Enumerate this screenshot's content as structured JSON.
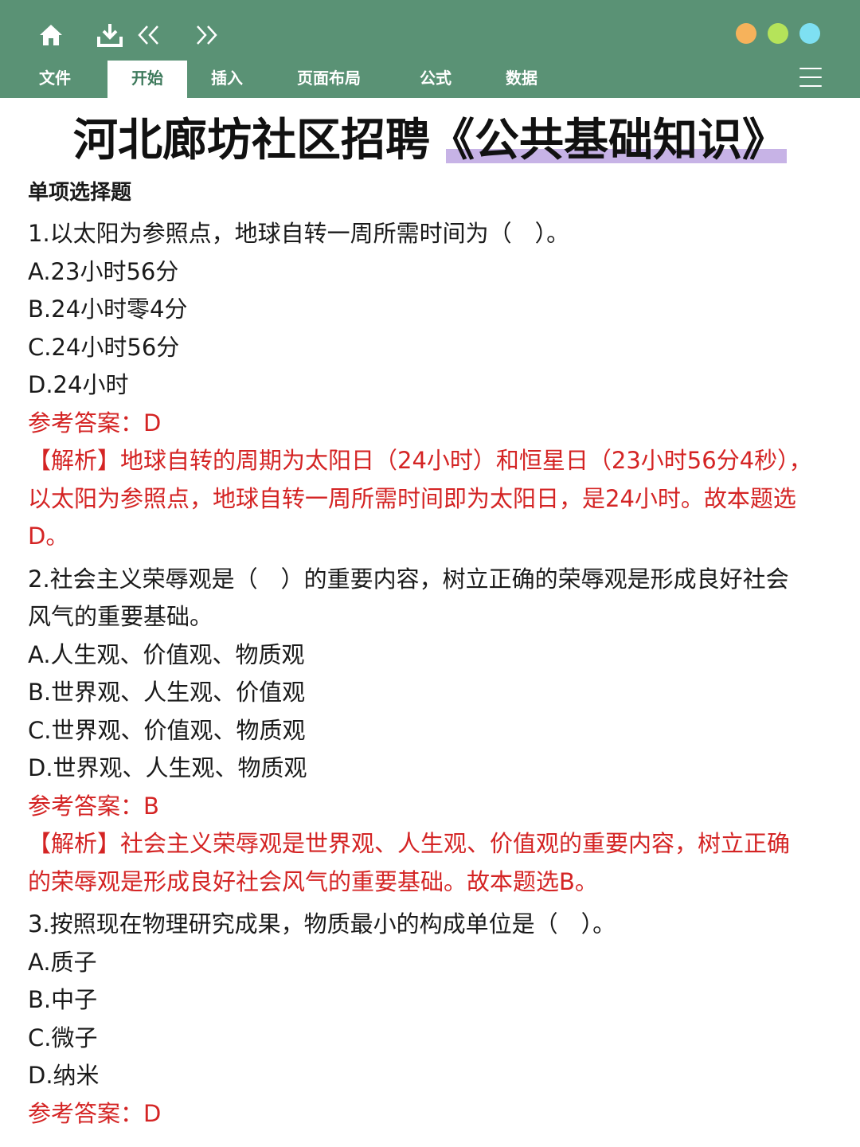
{
  "toolbar": {
    "icons": [
      "home-icon",
      "download-icon",
      "double-chevron-left-icon",
      "double-chevron-right-icon"
    ],
    "window_dots": [
      "#f6b25b",
      "#b5e35a",
      "#7ee0f2"
    ],
    "bar_color": "#5a9275",
    "tabs": [
      {
        "label": "文件",
        "active": false
      },
      {
        "label": "开始",
        "active": true
      },
      {
        "label": "插入",
        "active": false
      },
      {
        "label": "页面布局",
        "active": false
      },
      {
        "label": "公式",
        "active": false
      },
      {
        "label": "数据",
        "active": false
      }
    ],
    "menu_icon": "hamburger-menu-icon"
  },
  "doc": {
    "title": "河北廊坊社区招聘《公共基础知识》",
    "section": "单项选择题",
    "questions": [
      {
        "stem": [
          "1.以太阳为参照点，地球自转一周所需时间为（　）。"
        ],
        "options": [
          "A.23小时56分",
          "B.24小时零4分",
          "C.24小时56分",
          "D.24小时"
        ],
        "answer": "参考答案：D",
        "analysis": [
          "【解析】地球自转的周期为太阳日（24小时）和恒星日（23小时56分4秒），",
          "以太阳为参照点，地球自转一周所需时间即为太阳日，是24小时。故本题选",
          "D。"
        ]
      },
      {
        "stem": [
          "2.社会主义荣辱观是（　）的重要内容，树立正确的荣辱观是形成良好社会",
          "风气的重要基础。"
        ],
        "options": [
          "A.人生观、价值观、物质观",
          "B.世界观、人生观、价值观",
          "C.世界观、价值观、物质观",
          "D.世界观、人生观、物质观"
        ],
        "answer": "参考答案：B",
        "analysis": [
          "【解析】社会主义荣辱观是世界观、人生观、价值观的重要内容，树立正确",
          "的荣辱观是形成良好社会风气的重要基础。故本题选B。"
        ]
      },
      {
        "stem": [
          "3.按照现在物理研究成果，物质最小的构成单位是（　）。"
        ],
        "options": [
          "A.质子",
          "B.中子",
          "C.微子",
          "D.纳米"
        ],
        "answer": "参考答案：D",
        "analysis": []
      }
    ]
  }
}
